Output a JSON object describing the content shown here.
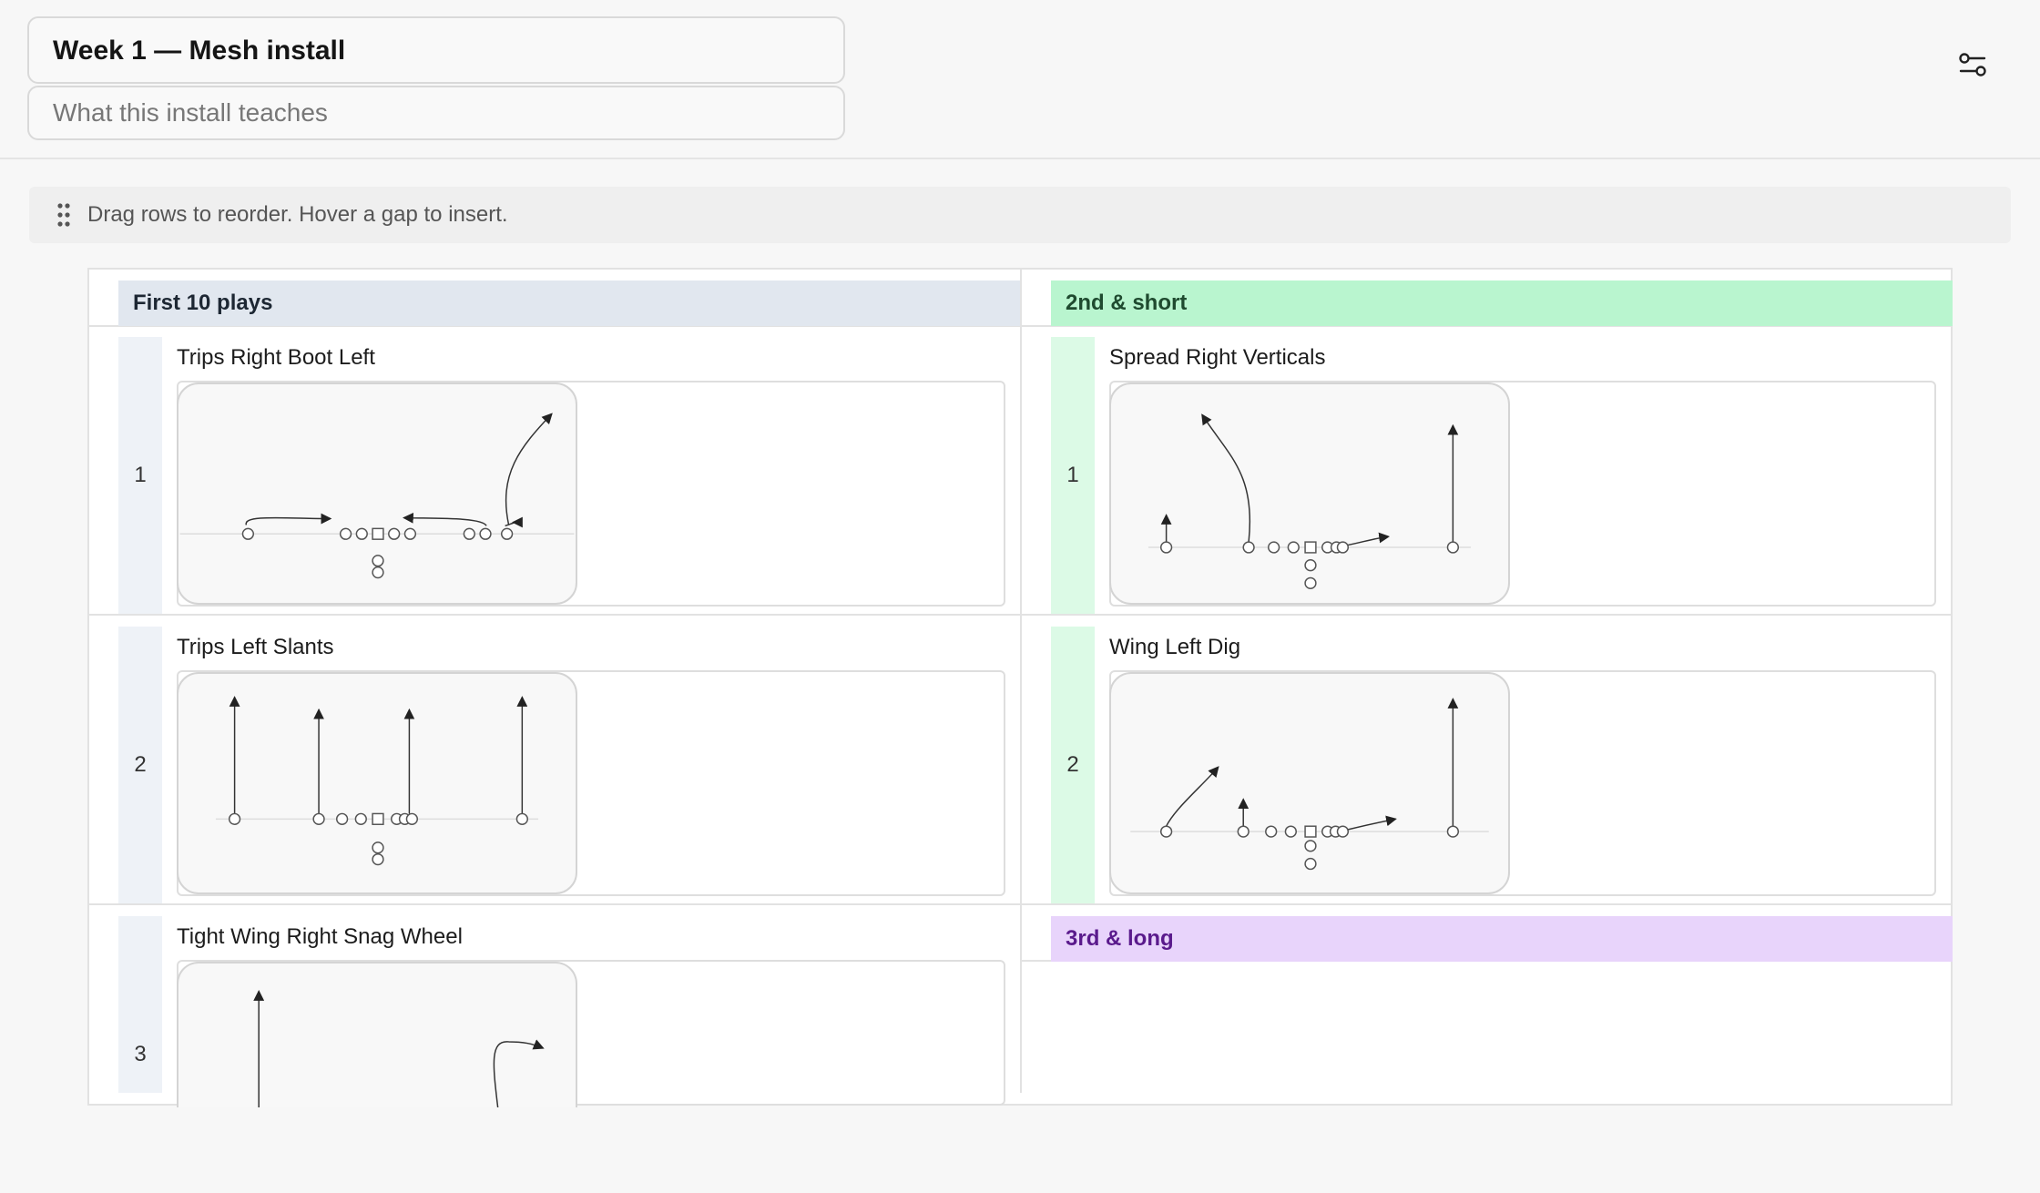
{
  "header": {
    "title": "Week 1 — Mesh install",
    "description_placeholder": "What this install teaches",
    "settings_icon": "sliders-icon"
  },
  "hint": {
    "icon": "drag-handle-icon",
    "text": "Drag rows to reorder. Hover a gap to insert."
  },
  "sections": [
    {
      "label": "First 10 plays",
      "color": "#e1e7ef",
      "plays": [
        {
          "number": "1",
          "name": "Trips Right Boot Left"
        },
        {
          "number": "2",
          "name": "Trips Left Slants"
        },
        {
          "number": "3",
          "name": "Tight Wing Right Snag Wheel"
        }
      ]
    },
    {
      "label": "2nd & short",
      "color": "#b9f5cf",
      "plays": [
        {
          "number": "1",
          "name": "Spread Right Verticals"
        },
        {
          "number": "2",
          "name": "Wing Left Dig"
        }
      ]
    },
    {
      "label": "3rd & long",
      "color": "#e8d4fb",
      "plays": []
    }
  ]
}
